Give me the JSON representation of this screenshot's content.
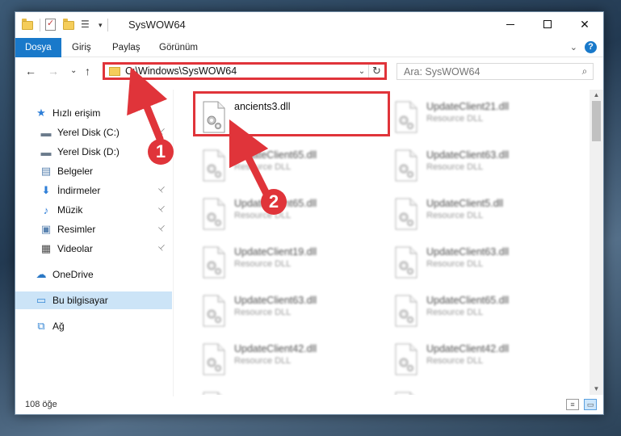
{
  "window": {
    "title": "SysWOW64",
    "controls": {
      "minimize_icon": "minimize-icon",
      "maximize_icon": "maximize-icon",
      "close_symbol": "✕"
    }
  },
  "ribbon": {
    "tabs": [
      {
        "label": "Dosya",
        "active": true
      },
      {
        "label": "Giriş",
        "active": false
      },
      {
        "label": "Paylaş",
        "active": false
      },
      {
        "label": "Görünüm",
        "active": false
      }
    ],
    "help_symbol": "?",
    "expand_symbol": "⌄"
  },
  "navigation": {
    "back_symbol": "←",
    "forward_symbol": "→",
    "recent_symbol": "⌄",
    "up_symbol": "↑",
    "address": "C:\\Windows\\SysWOW64",
    "address_dropdown_symbol": "⌄",
    "refresh_symbol": "↻",
    "search_placeholder": "Ara: SysWOW64",
    "search_icon": "⌕"
  },
  "sidebar": {
    "items": [
      {
        "label": "Hızlı erişim",
        "icon": "star-icon",
        "glyph": "★",
        "color": "#2f7fd8",
        "pinned": false,
        "selected": false
      },
      {
        "label": "Yerel Disk (C:)",
        "icon": "drive-icon",
        "glyph": "▬",
        "color": "#6b7b8c",
        "pinned": true,
        "selected": false
      },
      {
        "label": "Yerel Disk (D:)",
        "icon": "drive-icon",
        "glyph": "▬",
        "color": "#6b7b8c",
        "pinned": false,
        "selected": false
      },
      {
        "label": "Belgeler",
        "icon": "documents-icon",
        "glyph": "▤",
        "color": "#5b84b1",
        "pinned": false,
        "selected": false
      },
      {
        "label": "İndirmeler",
        "icon": "downloads-icon",
        "glyph": "⬇",
        "color": "#2f7fd8",
        "pinned": true,
        "selected": false
      },
      {
        "label": "Müzik",
        "icon": "music-icon",
        "glyph": "♪",
        "color": "#2f7fd8",
        "pinned": true,
        "selected": false
      },
      {
        "label": "Resimler",
        "icon": "pictures-icon",
        "glyph": "▣",
        "color": "#5b84b1",
        "pinned": true,
        "selected": false
      },
      {
        "label": "Videolar",
        "icon": "videos-icon",
        "glyph": "▦",
        "color": "#4a4a4a",
        "pinned": true,
        "selected": false
      },
      {
        "label": "OneDrive",
        "icon": "cloud-icon",
        "glyph": "☁",
        "color": "#2b78c5",
        "pinned": false,
        "selected": false
      },
      {
        "label": "Bu bilgisayar",
        "icon": "computer-icon",
        "glyph": "▭",
        "color": "#3a8ad6",
        "pinned": false,
        "selected": true
      },
      {
        "label": "Ağ",
        "icon": "network-icon",
        "glyph": "⧉",
        "color": "#3a8ad6",
        "pinned": false,
        "selected": false
      }
    ],
    "pin_symbol": "📌"
  },
  "files": [
    {
      "name": "ancients3.dll",
      "type": "",
      "highlighted": true
    },
    {
      "name": "UpdateClient21.dll",
      "type": "Resource DLL",
      "highlighted": false
    },
    {
      "name": "UpdateClient65.dll",
      "type": "Resource DLL",
      "highlighted": false
    },
    {
      "name": "UpdateClient63.dll",
      "type": "Resource DLL",
      "highlighted": false
    },
    {
      "name": "UpdateClient65.dll",
      "type": "Resource DLL",
      "highlighted": false
    },
    {
      "name": "UpdateClient5.dll",
      "type": "Resource DLL",
      "highlighted": false
    },
    {
      "name": "UpdateClient19.dll",
      "type": "Resource DLL",
      "highlighted": false
    },
    {
      "name": "UpdateClient63.dll",
      "type": "Resource DLL",
      "highlighted": false
    },
    {
      "name": "UpdateClient63.dll",
      "type": "Resource DLL",
      "highlighted": false
    },
    {
      "name": "UpdateClient65.dll",
      "type": "Resource DLL",
      "highlighted": false
    },
    {
      "name": "UpdateClient42.dll",
      "type": "Resource DLL",
      "highlighted": false
    },
    {
      "name": "UpdateClient42.dll",
      "type": "Resource DLL",
      "highlighted": false
    },
    {
      "name": "",
      "type": "",
      "highlighted": false
    },
    {
      "name": "",
      "type": "",
      "highlighted": false
    }
  ],
  "status": {
    "item_count": "108 öğe"
  },
  "annotations": {
    "step1": "1",
    "step2": "2",
    "accent_color": "#e0343a"
  }
}
